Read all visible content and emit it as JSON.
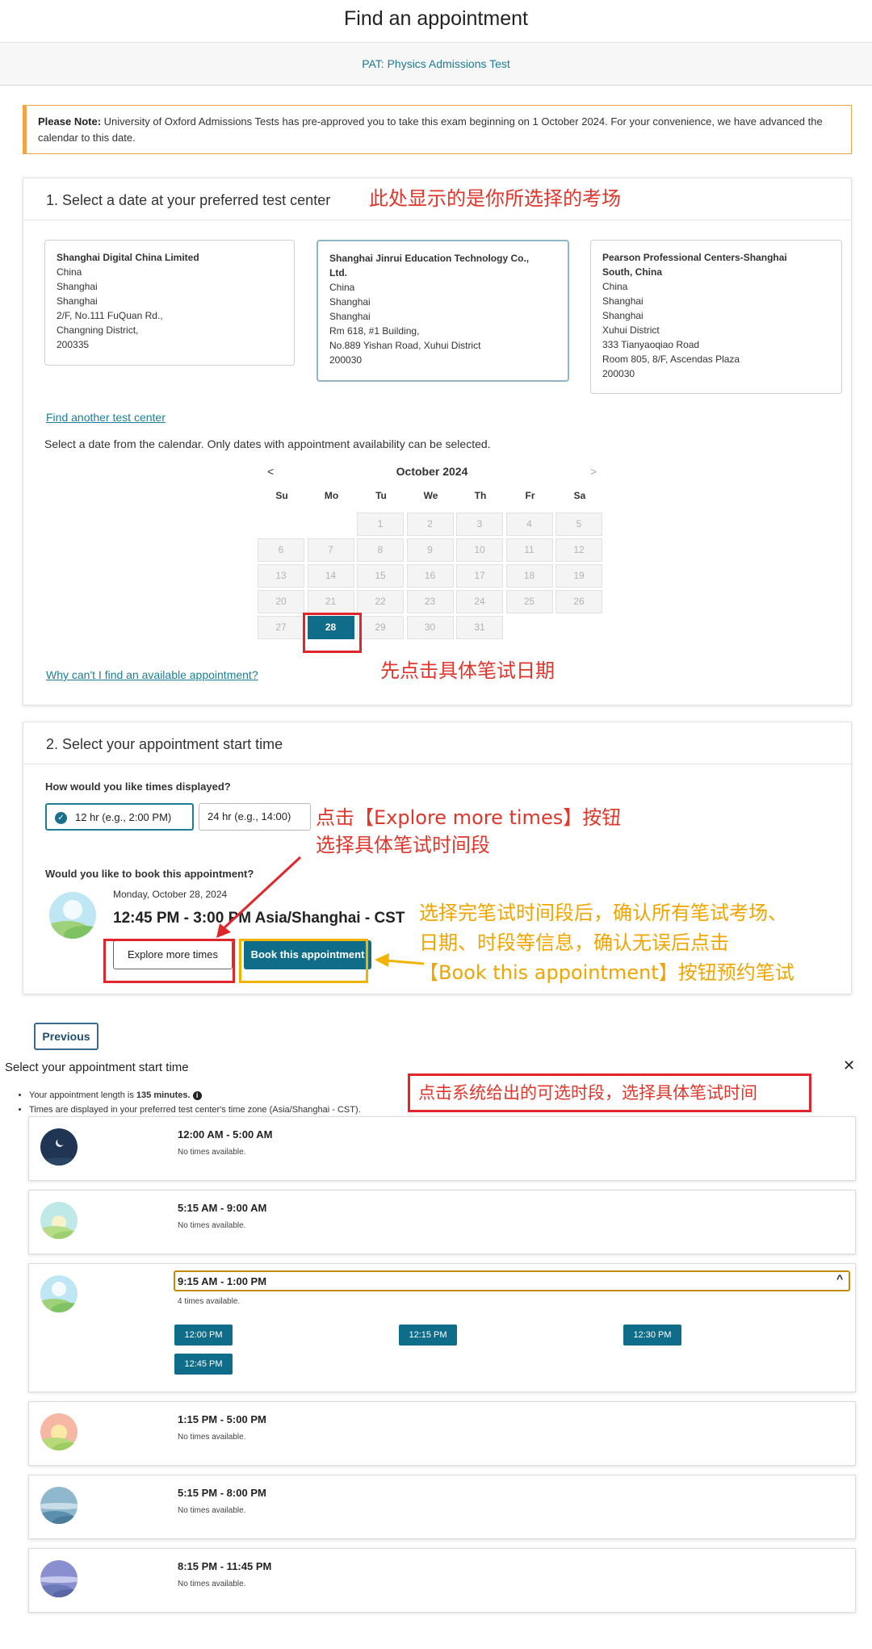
{
  "header": {
    "title": "Find an appointment",
    "exam": "PAT: Physics Admissions Test"
  },
  "note": {
    "bold": "Please Note:",
    "text": " University of Oxford Admissions Tests has pre-approved you to take this exam beginning on 1 October 2024. For your convenience, we have advanced the calendar to this date."
  },
  "section1": {
    "title": "1. Select a date at your preferred test center",
    "annotation": "此处显示的是你所选择的考场",
    "centers": [
      {
        "name1": "Shanghai Digital China Limited",
        "name2": "",
        "lines": [
          "China",
          "Shanghai",
          "Shanghai",
          "2/F, No.111 FuQuan Rd.,",
          "Changning District,",
          "200335"
        ]
      },
      {
        "name1": "Shanghai Jinrui Education Technology Co.,",
        "name2": "Ltd.",
        "lines": [
          "China",
          "Shanghai",
          "Shanghai",
          "Rm 618, #1 Building,",
          "No.889 Yishan Road, Xuhui District",
          "200030"
        ]
      },
      {
        "name1": "Pearson Professional Centers-Shanghai",
        "name2": "South, China",
        "lines": [
          "China",
          "Shanghai",
          "Shanghai",
          "Xuhui District",
          "333 Tianyaoqiao Road",
          "Room 805, 8/F, Ascendas Plaza",
          "200030"
        ]
      }
    ],
    "find_another": "Find another test center",
    "instruction": "Select a date from the calendar. Only dates with appointment availability can be selected.",
    "calendar": {
      "prev": "<",
      "next": ">",
      "month": "October 2024",
      "dows": [
        "Su",
        "Mo",
        "Tu",
        "We",
        "Th",
        "Fr",
        "Sa"
      ],
      "first_dow": 2,
      "days": 31,
      "lead_blank_weeks_prefix": [
        6
      ],
      "selected": 28
    },
    "why_link": "Why can't I find an available appointment?",
    "annotation_date": "先点击具体笔试日期"
  },
  "section2": {
    "title": "2. Select your appointment start time",
    "question_display": "How would you like times displayed?",
    "opt12": "12 hr (e.g., 2:00 PM)",
    "opt24": "24 hr (e.g., 14:00)",
    "check": "✓",
    "question_book": "Would you like to book this appointment?",
    "appt_date": "Monday, October 28, 2024",
    "appt_time": "12:45 PM - 3:00 PM Asia/Shanghai - CST",
    "explore_btn": "Explore more times",
    "book_btn": "Book this appointment",
    "annotation_explore_1": "点击【Explore more times】按钮",
    "annotation_explore_2": "选择具体笔试时间段",
    "annotation_book_1": "选择完笔试时间段后，确认所有笔试考场、",
    "annotation_book_2": "日期、时段等信息，确认无误后点击",
    "annotation_book_3": "【Book this appointment】按钮预约笔试"
  },
  "previous_btn": "Previous",
  "panel": {
    "title": "Select your appointment start time",
    "close": "✕",
    "bullet1_a": "Your appointment length is ",
    "bullet1_b": "135 minutes.",
    "info": "i",
    "bullet2": "Times are displayed in your preferred test center's time zone (Asia/Shanghai - CST).",
    "annotation": "点击系统给出的可选时段，选择具体笔试时间",
    "chevron": "^",
    "slots": [
      {
        "range": "12:00 AM - 5:00 AM",
        "avail": "No times available.",
        "icon": "night-moon-icon"
      },
      {
        "range": "5:15 AM - 9:00 AM",
        "avail": "No times available.",
        "icon": "sunrise-icon"
      },
      {
        "range": "9:15 AM - 1:00 PM",
        "avail": "4 times available.",
        "icon": "morning-sun-icon",
        "times": [
          "12:00 PM",
          "12:15 PM",
          "12:30 PM",
          "12:45 PM"
        ]
      },
      {
        "range": "1:15 PM - 5:00 PM",
        "avail": "No times available.",
        "icon": "afternoon-sun-icon"
      },
      {
        "range": "5:15 PM - 8:00 PM",
        "avail": "No times available.",
        "icon": "evening-icon"
      },
      {
        "range": "8:15 PM - 11:45 PM",
        "avail": "No times available.",
        "icon": "late-evening-icon"
      }
    ]
  },
  "colors": {
    "accent": "#0f6d8a",
    "note_border": "#f0a446",
    "annotation_red": "#e0362c",
    "annotation_yellow": "#f0a500"
  }
}
